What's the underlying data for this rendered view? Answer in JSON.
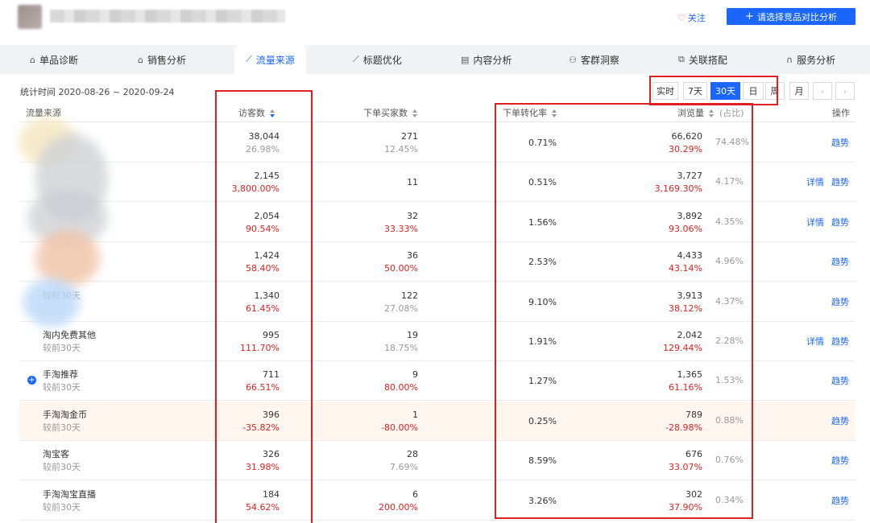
{
  "header": {
    "follow_label": "关注",
    "compare_label": "请选择竞品对比分析"
  },
  "tabs": [
    {
      "label": "单品诊断",
      "icon": "box-icon"
    },
    {
      "label": "销售分析",
      "icon": "bag-icon"
    },
    {
      "label": "流量来源",
      "icon": "trend-icon"
    },
    {
      "label": "标题优化",
      "icon": "trend-icon"
    },
    {
      "label": "内容分析",
      "icon": "doc-icon"
    },
    {
      "label": "客群洞察",
      "icon": "users-icon"
    },
    {
      "label": "关联搭配",
      "icon": "link-icon"
    },
    {
      "label": "服务分析",
      "icon": "headset-icon"
    }
  ],
  "active_tab": "流量来源",
  "toolbar": {
    "stat_time": "统计时间 2020-08-26 ~ 2020-09-24",
    "periods": [
      "实时",
      "7天",
      "30天",
      "日",
      "周",
      "月"
    ],
    "active_period": "30天"
  },
  "table": {
    "headers": {
      "source": "流量来源",
      "visitors": "访客数",
      "buyers": "下单买家数",
      "conversion": "下单转化率",
      "pageviews": "浏览量",
      "share": "(占比)",
      "action": "操作"
    },
    "rows": [
      {
        "name": "",
        "compare": "",
        "visitors": "38,044",
        "visitors_chg": "26.98%",
        "visitors_chg_red": false,
        "buyers": "271",
        "buyers_chg": "12.45%",
        "buyers_chg_red": false,
        "conversion": "0.71%",
        "pv": "66,620",
        "pv_chg": "30.29%",
        "share": "74.48%",
        "detail": "",
        "trend": "趋势",
        "expand": false
      },
      {
        "name": "",
        "compare": "",
        "visitors": "2,145",
        "visitors_chg": "3,800.00%",
        "visitors_chg_red": true,
        "buyers": "11",
        "buyers_chg": "",
        "buyers_chg_red": false,
        "conversion": "0.51%",
        "pv": "3,727",
        "pv_chg": "3,169.30%",
        "share": "4.17%",
        "detail": "详情",
        "trend": "趋势",
        "expand": false
      },
      {
        "name": "",
        "compare": "",
        "visitors": "2,054",
        "visitors_chg": "90.54%",
        "visitors_chg_red": true,
        "buyers": "32",
        "buyers_chg": "33.33%",
        "buyers_chg_red": true,
        "conversion": "1.56%",
        "pv": "3,892",
        "pv_chg": "93.06%",
        "share": "4.35%",
        "detail": "详情",
        "trend": "趋势",
        "expand": false
      },
      {
        "name": "",
        "compare": "",
        "visitors": "1,424",
        "visitors_chg": "58.40%",
        "visitors_chg_red": true,
        "buyers": "36",
        "buyers_chg": "50.00%",
        "buyers_chg_red": true,
        "conversion": "2.53%",
        "pv": "4,433",
        "pv_chg": "43.14%",
        "share": "4.96%",
        "detail": "",
        "trend": "趋势",
        "expand": false
      },
      {
        "name": "",
        "compare": "较前30天",
        "visitors": "1,340",
        "visitors_chg": "61.45%",
        "visitors_chg_red": true,
        "buyers": "122",
        "buyers_chg": "27.08%",
        "buyers_chg_red": false,
        "conversion": "9.10%",
        "pv": "3,913",
        "pv_chg": "38.12%",
        "share": "4.37%",
        "detail": "",
        "trend": "趋势",
        "expand": false
      },
      {
        "name": "淘内免费其他",
        "compare": "较前30天",
        "visitors": "995",
        "visitors_chg": "111.70%",
        "visitors_chg_red": true,
        "buyers": "19",
        "buyers_chg": "18.75%",
        "buyers_chg_red": false,
        "conversion": "1.91%",
        "pv": "2,042",
        "pv_chg": "129.44%",
        "share": "2.28%",
        "detail": "详情",
        "trend": "趋势",
        "expand": false
      },
      {
        "name": "手淘推荐",
        "compare": "较前30天",
        "visitors": "711",
        "visitors_chg": "66.51%",
        "visitors_chg_red": true,
        "buyers": "9",
        "buyers_chg": "80.00%",
        "buyers_chg_red": true,
        "conversion": "1.27%",
        "pv": "1,365",
        "pv_chg": "61.16%",
        "share": "1.53%",
        "detail": "",
        "trend": "趋势",
        "expand": true
      },
      {
        "name": "手淘淘金币",
        "compare": "较前30天",
        "visitors": "396",
        "visitors_chg": "-35.82%",
        "visitors_chg_red": true,
        "buyers": "1",
        "buyers_chg": "-80.00%",
        "buyers_chg_red": true,
        "conversion": "0.25%",
        "pv": "789",
        "pv_chg": "-28.98%",
        "share": "0.88%",
        "detail": "",
        "trend": "趋势",
        "expand": false
      },
      {
        "name": "淘宝客",
        "compare": "较前30天",
        "visitors": "326",
        "visitors_chg": "31.98%",
        "visitors_chg_red": true,
        "buyers": "28",
        "buyers_chg": "7.69%",
        "buyers_chg_red": false,
        "conversion": "8.59%",
        "pv": "676",
        "pv_chg": "33.07%",
        "share": "0.76%",
        "detail": "",
        "trend": "趋势",
        "expand": false
      },
      {
        "name": "手淘淘宝直播",
        "compare": "较前30天",
        "visitors": "184",
        "visitors_chg": "54.62%",
        "visitors_chg_red": true,
        "buyers": "6",
        "buyers_chg": "200.00%",
        "buyers_chg_red": true,
        "conversion": "3.26%",
        "pv": "302",
        "pv_chg": "37.90%",
        "share": "0.34%",
        "detail": "",
        "trend": "趋势",
        "expand": false
      }
    ]
  },
  "colors": {
    "accent": "#1a66ff",
    "negative": "#e02020",
    "highlight_row": "#fff6ef",
    "annotation": "#e02020"
  }
}
